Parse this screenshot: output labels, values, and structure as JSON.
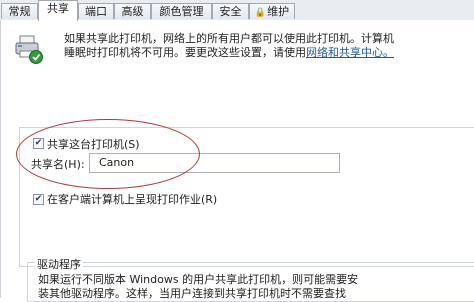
{
  "tabs": [
    {
      "label": "常规",
      "active": false
    },
    {
      "label": "共享",
      "active": true
    },
    {
      "label": "端口",
      "active": false
    },
    {
      "label": "高级",
      "active": false
    },
    {
      "label": "颜色管理",
      "active": false
    },
    {
      "label": "安全",
      "active": false
    },
    {
      "label": "维护",
      "active": false,
      "icon": "lock-icon"
    }
  ],
  "sharing": {
    "description_line1": "如果共享此打印机，网络上的所有用户都可以使用此打印机。计算机",
    "description_line2_prefix": "睡眠时打印机将不可用。要更改这些设置，请使用",
    "description_link": "网络和共享中心。",
    "share_checkbox_label": "共享这台打印机(S)",
    "share_checked": true,
    "share_name_label": "共享名(H):",
    "share_name_value": "Canon",
    "render_jobs_label": "在客户端计算机上呈现打印作业(R)",
    "render_jobs_checked": true
  },
  "drivers": {
    "title": "驱动程序",
    "text_line1": "如果运行不同版本 Windows 的用户共享此打印机，则可能需要安",
    "text_line2": "装其他驱动程序。这样，当用户连接到共享打印机时不需要查找"
  },
  "colors": {
    "highlight_ellipse": "#b43838",
    "link": "#1a5aa8"
  }
}
